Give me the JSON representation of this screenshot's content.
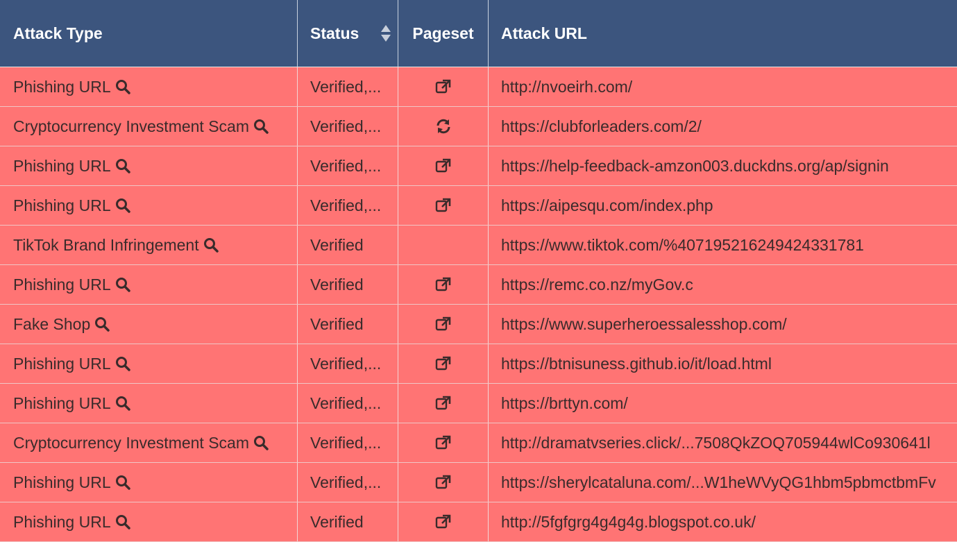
{
  "table": {
    "headers": {
      "attack_type": "Attack Type",
      "status": "Status",
      "pageset": "Pageset",
      "attack_url": "Attack URL"
    },
    "rows": [
      {
        "attack_type": "Phishing URL",
        "status": "Verified,...",
        "pageset_icon": "external-link-icon",
        "url": "http://nvoeirh.com/"
      },
      {
        "attack_type": "Cryptocurrency Investment Scam",
        "status": "Verified,...",
        "pageset_icon": "refresh-icon",
        "url": "https://clubforleaders.com/2/"
      },
      {
        "attack_type": "Phishing URL",
        "status": "Verified,...",
        "pageset_icon": "external-link-icon",
        "url": "https://help-feedback-amzon003.duckdns.org/ap/signin"
      },
      {
        "attack_type": "Phishing URL",
        "status": "Verified,...",
        "pageset_icon": "external-link-icon",
        "url": "https://aipesqu.com/index.php"
      },
      {
        "attack_type": "TikTok Brand Infringement",
        "status": "Verified",
        "pageset_icon": "",
        "url": "https://www.tiktok.com/%4071952162494243317​81"
      },
      {
        "attack_type": "Phishing URL",
        "status": "Verified",
        "pageset_icon": "external-link-icon",
        "url": "https://remc.co.nz/myGov.c"
      },
      {
        "attack_type": "Fake Shop",
        "status": "Verified",
        "pageset_icon": "external-link-icon",
        "url": "https://www.superheroessalesshop.com/"
      },
      {
        "attack_type": "Phishing URL",
        "status": "Verified,...",
        "pageset_icon": "external-link-icon",
        "url": "https://btnisuness.github.io/it/load.html"
      },
      {
        "attack_type": "Phishing URL",
        "status": "Verified,...",
        "pageset_icon": "external-link-icon",
        "url": "https://brttyn.com/"
      },
      {
        "attack_type": "Cryptocurrency Investment Scam",
        "status": "Verified,...",
        "pageset_icon": "external-link-icon",
        "url": "http://dramatvseries.click/...7508QkZOQ705944wlCo930641l"
      },
      {
        "attack_type": "Phishing URL",
        "status": "Verified,...",
        "pageset_icon": "external-link-icon",
        "url": "https://sherylcataluna.com/...W1heWVyQG1hbm5pbmctbmFv"
      },
      {
        "attack_type": "Phishing URL",
        "status": "Verified",
        "pageset_icon": "external-link-icon",
        "url": "http://5fgfgrg4g4g4g.blogspot.co.uk/"
      }
    ]
  },
  "colors": {
    "header_bg": "#3c557e",
    "row_bg": "#ff7474",
    "text": "#3a2b2b"
  }
}
